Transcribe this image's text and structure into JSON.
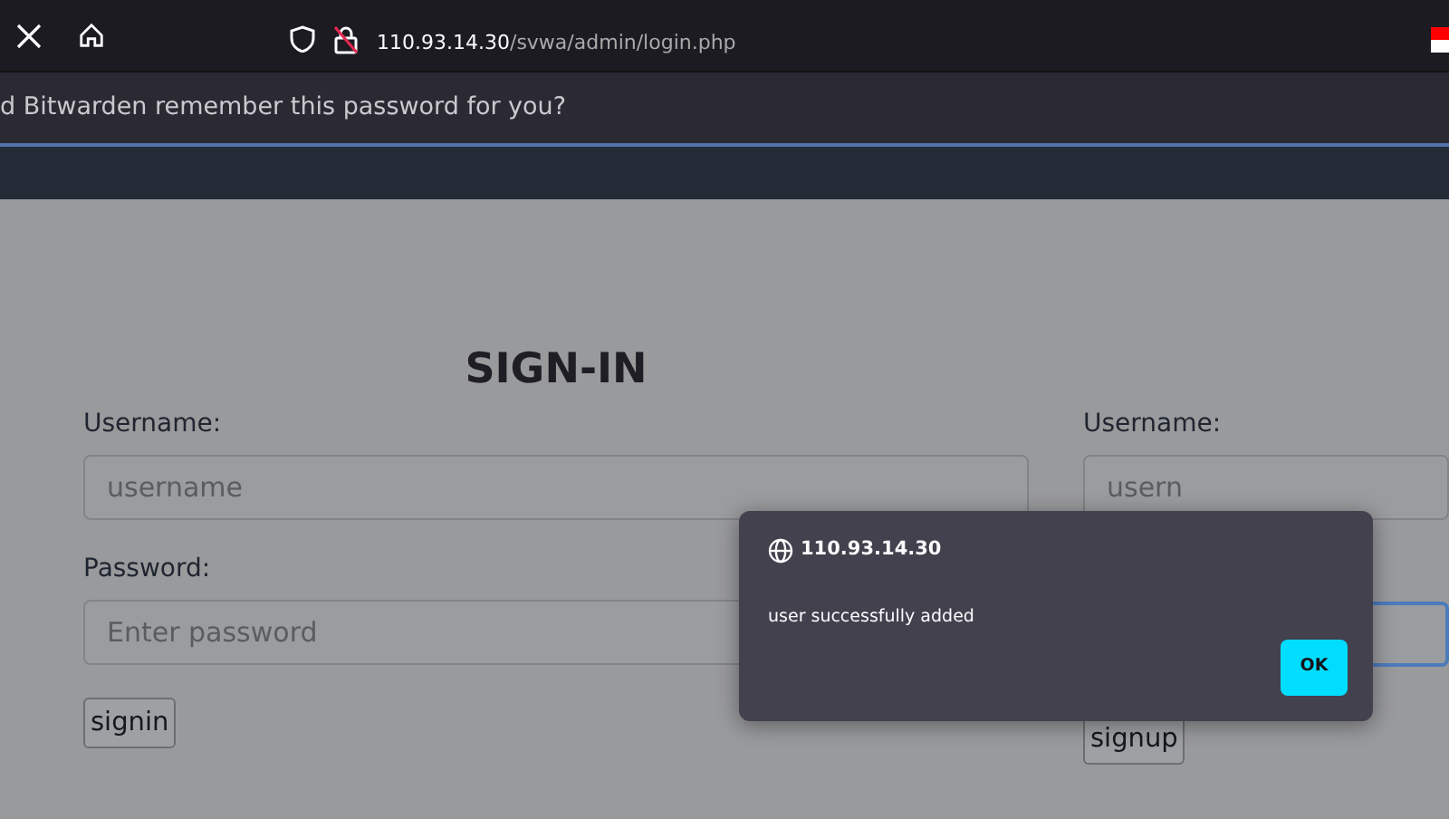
{
  "browser": {
    "url_host": "110.93.14.30",
    "url_path": "/svwa/admin/login.php"
  },
  "password_prompt": {
    "text": "d Bitwarden remember this password for you?"
  },
  "signin": {
    "title": "SIGN-IN",
    "fields": [
      {
        "label": "Username:",
        "placeholder": "username",
        "focused": false
      },
      {
        "label": "Password:",
        "placeholder": "Enter password",
        "focused": false
      }
    ],
    "button": "signin"
  },
  "signup": {
    "fields": [
      {
        "label": "Username:",
        "placeholder": "usern",
        "focused": false
      },
      {
        "focused": true
      }
    ],
    "button": "signup"
  },
  "dialog": {
    "origin": "110.93.14.30",
    "message": "user successfully added",
    "button": "OK"
  }
}
